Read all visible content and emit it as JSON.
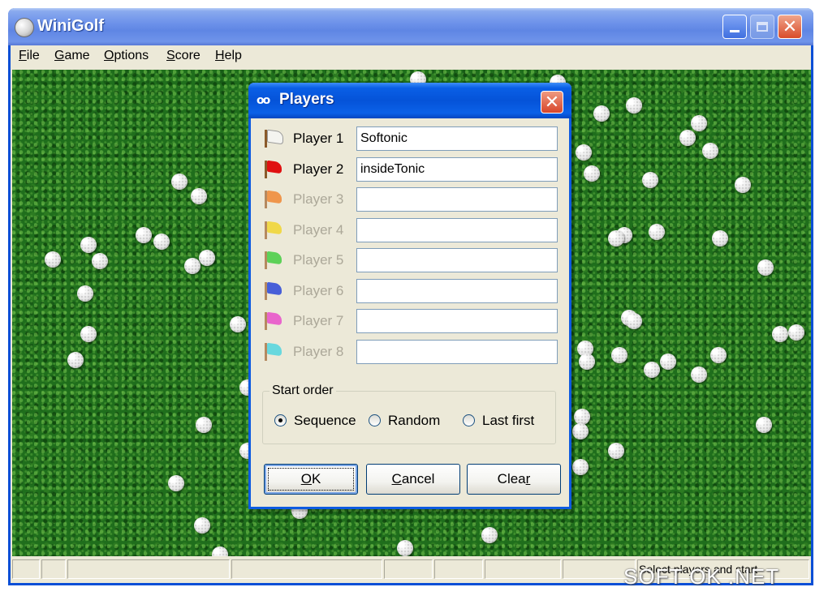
{
  "window": {
    "title": "WiniGolf",
    "close_glyph": "✕"
  },
  "menu": [
    {
      "id": "file",
      "accel": "F",
      "rest": "ile"
    },
    {
      "id": "game",
      "accel": "G",
      "rest": "ame"
    },
    {
      "id": "options",
      "accel": "O",
      "rest": "ptions"
    },
    {
      "id": "score",
      "accel": "S",
      "rest": "core"
    },
    {
      "id": "help",
      "accel": "H",
      "rest": "elp"
    }
  ],
  "dialog": {
    "title": "Players",
    "icon_glyph": "oo",
    "close_glyph": "✕",
    "players": [
      {
        "label": "Player 1",
        "value": "Softonic",
        "enabled": true,
        "flag_color": "#f4f4f0"
      },
      {
        "label": "Player 2",
        "value": "insideTonic",
        "enabled": true,
        "flag_color": "#e01010"
      },
      {
        "label": "Player 3",
        "value": "",
        "enabled": false,
        "flag_color": "#f07a1e"
      },
      {
        "label": "Player 4",
        "value": "",
        "enabled": false,
        "flag_color": "#f2d21a"
      },
      {
        "label": "Player 5",
        "value": "",
        "enabled": false,
        "flag_color": "#2ec82e"
      },
      {
        "label": "Player 6",
        "value": "",
        "enabled": false,
        "flag_color": "#1030d8"
      },
      {
        "label": "Player 7",
        "value": "",
        "enabled": false,
        "flag_color": "#e838c8"
      },
      {
        "label": "Player 8",
        "value": "",
        "enabled": false,
        "flag_color": "#3cd2e0"
      }
    ],
    "start_order": {
      "legend": "Start order",
      "options": [
        {
          "label": "Sequence",
          "checked": true
        },
        {
          "label": "Random",
          "checked": false
        },
        {
          "label": "Last first",
          "checked": false
        }
      ]
    },
    "buttons": {
      "ok_accel": "O",
      "ok_rest": "K",
      "cancel_accel": "C",
      "cancel_rest": "ancel",
      "clear_pre": "Clea",
      "clear_accel": "r"
    }
  },
  "statusbar": {
    "text": "Select players and start"
  },
  "watermark": "SOFT OK .NET",
  "colors": {
    "title_blue": "#0553d8",
    "grass": "#1f6e1c",
    "dialog_bg": "#ece9d8"
  }
}
